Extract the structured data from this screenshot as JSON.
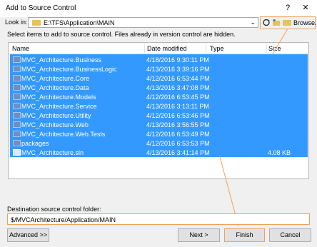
{
  "window": {
    "title": "Add to Source Control",
    "help_label": "?",
    "close_label": "✕"
  },
  "lookin": {
    "label": "Look in:",
    "value": "E:\\TFS\\Application\\MAIN"
  },
  "toolbar": {
    "browse_label": "Browse..."
  },
  "hint": "Select items to add to source control. Files already in version control are hidden.",
  "list": {
    "headers": {
      "name": "Name",
      "date": "Date modified",
      "type": "Type",
      "size": "Size"
    },
    "items": [
      {
        "name": "MVC_Architecture.Business",
        "date": "4/18/2016 9:30:11 PM",
        "type": "",
        "size": "",
        "icon": "folder-icon"
      },
      {
        "name": "MVC_Architecture.BusinessLogic",
        "date": "4/13/2016 3:39:16 PM",
        "type": "",
        "size": "",
        "icon": "folder-icon"
      },
      {
        "name": "MVC_Architecture.Core",
        "date": "4/12/2016 6:53:44 PM",
        "type": "",
        "size": "",
        "icon": "folder-icon"
      },
      {
        "name": "MVC_Architecture.Data",
        "date": "4/13/2016 3:47:08 PM",
        "type": "",
        "size": "",
        "icon": "folder-icon"
      },
      {
        "name": "MVC_Architecture.Models",
        "date": "4/12/2016 6:53:45 PM",
        "type": "",
        "size": "",
        "icon": "folder-icon"
      },
      {
        "name": "MVC_Architecture.Service",
        "date": "4/13/2016 3:13:11 PM",
        "type": "",
        "size": "",
        "icon": "folder-icon"
      },
      {
        "name": "MVC_Architecture.Utility",
        "date": "4/12/2016 6:53:46 PM",
        "type": "",
        "size": "",
        "icon": "folder-icon"
      },
      {
        "name": "MVC_Architecture.Web",
        "date": "4/13/2016 3:56:55 PM",
        "type": "",
        "size": "",
        "icon": "folder-icon"
      },
      {
        "name": "MVC_Architecture.Web.Tests",
        "date": "4/12/2016 6:53:49 PM",
        "type": "",
        "size": "",
        "icon": "folder-icon"
      },
      {
        "name": "packages",
        "date": "4/12/2016 6:53:53 PM",
        "type": "",
        "size": "",
        "icon": "folder-icon"
      },
      {
        "name": "MVC_Architecture.sln",
        "date": "4/13/2016 3:41:14 PM",
        "type": "",
        "size": "4.08 KB",
        "icon": "solution-file-icon"
      }
    ]
  },
  "destination": {
    "label": "Destination source control folder:",
    "value": "$/MVCArchitecture/Application/MAIN"
  },
  "buttons": {
    "advanced": "Advanced >>",
    "next": "Next >",
    "finish": "Finish",
    "cancel": "Cancel"
  }
}
